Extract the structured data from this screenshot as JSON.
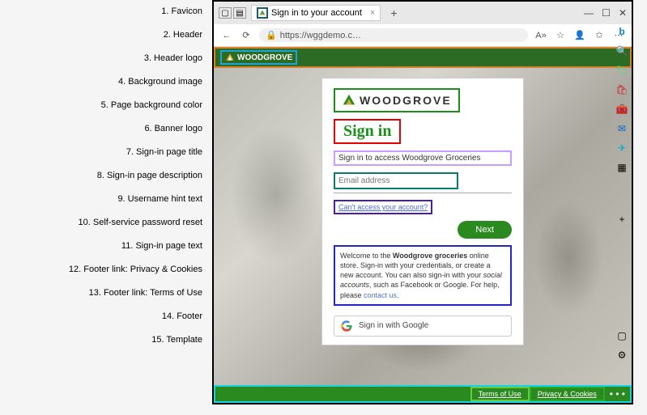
{
  "annotations": [
    "1. Favicon",
    "2. Header",
    "3. Header logo",
    "4. Background image",
    "5. Page background color",
    "6. Banner logo",
    "7. Sign-in page title",
    "8. Sign-in page description",
    "9. Username hint text",
    "10. Self-service password reset",
    "11. Sign-in page text",
    "12. Footer link: Privacy & Cookies",
    "13. Footer link: Terms of Use",
    "14. Footer",
    "15. Template"
  ],
  "browser": {
    "tab_title": "Sign in to your account",
    "url": "https://wggdemo.c…",
    "plus": "+",
    "win_min": "—",
    "win_max": "☐",
    "win_close": "✕",
    "back": "←",
    "reload": "⟳",
    "lock": "🔒",
    "more": "⋯"
  },
  "header": {
    "brand": "WOODGROVE"
  },
  "signin": {
    "banner_brand": "WOODGROVE",
    "title": "Sign in",
    "description": "Sign in to access Woodgrove Groceries",
    "username_placeholder": "Email address",
    "sspr_text": "Can't access your account?",
    "next_label": "Next",
    "page_text_plain_1": "Welcome to the ",
    "page_text_bold_1": "Woodgrove groceries",
    "page_text_plain_2": " online store. Sign-in with your credentials, or create a new account. You can also sign-in with your ",
    "page_text_italic_1": "social accounts",
    "page_text_plain_3": ", such as Facebook or Google. For help, please ",
    "page_text_link": "contact us",
    "page_text_plain_4": ".",
    "google_label": "Sign in with Google"
  },
  "footer": {
    "terms": "Terms of Use",
    "privacy": "Privacy & Cookies",
    "more": "• • •"
  },
  "colors": {
    "header_bg": "#2b6b23",
    "footer_bg": "#2b8a1f",
    "accent_green": "#1a8f1a"
  }
}
